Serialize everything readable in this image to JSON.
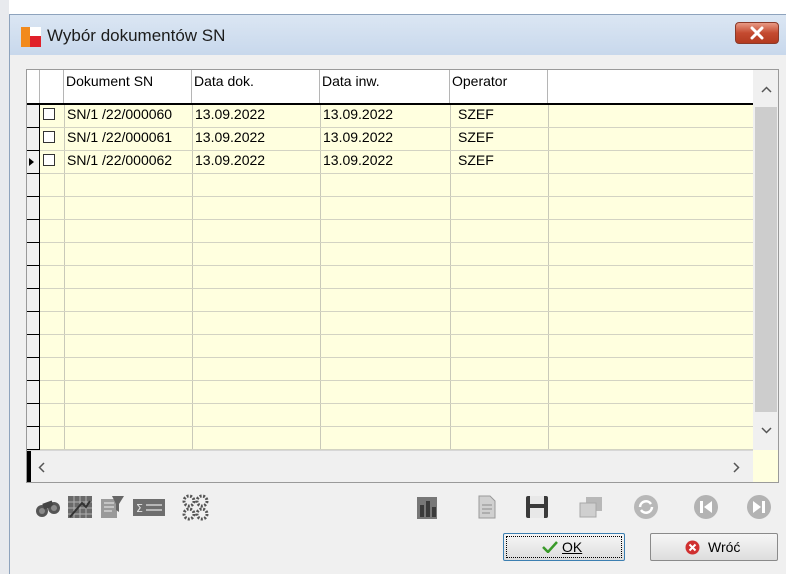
{
  "window": {
    "title": "Wybór dokumentów SN"
  },
  "grid": {
    "columns": [
      "Dokument SN",
      "Data dok.",
      "Data inw.",
      "Operator"
    ],
    "rows": [
      {
        "checked": false,
        "current": false,
        "document": "SN/1  /22/000060",
        "doc_date": "13.09.2022",
        "inv_date": "13.09.2022",
        "operator": "SZEF"
      },
      {
        "checked": false,
        "current": false,
        "document": "SN/1  /22/000061",
        "doc_date": "13.09.2022",
        "inv_date": "13.09.2022",
        "operator": "SZEF"
      },
      {
        "checked": false,
        "current": true,
        "document": "SN/1  /22/000062",
        "doc_date": "13.09.2022",
        "inv_date": "13.09.2022",
        "operator": "SZEF"
      }
    ],
    "scroll_up": "^",
    "scroll_down": "v",
    "scroll_left": "<",
    "scroll_right": ">"
  },
  "toolbar": {
    "icons": [
      "binoculars-icon",
      "grid-layout-icon",
      "filter-icon",
      "sum-icon",
      "settings-gears-icon",
      "report-icon",
      "document-icon",
      "save-icon",
      "copy-icon",
      "refresh-icon",
      "first-record-icon",
      "last-record-icon"
    ]
  },
  "buttons": {
    "ok_label": "OK",
    "back_label": "Wróć"
  },
  "colors": {
    "grid_background": "#ffffdf",
    "title_bar": "#c8d8ec",
    "close_button": "#c44a30",
    "ok_check": "#3a9a2a",
    "back_icon": "#d03030"
  }
}
